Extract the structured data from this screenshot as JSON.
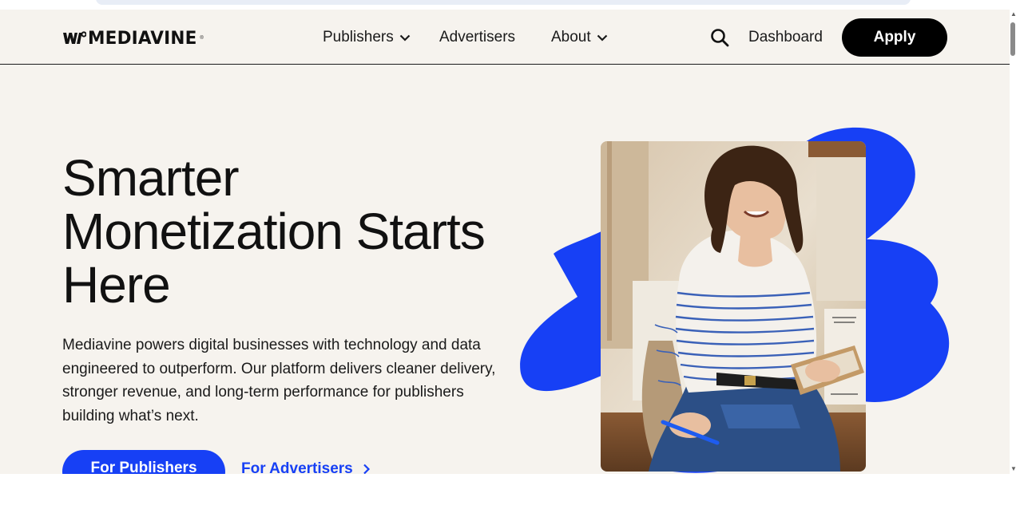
{
  "brand": {
    "name": "MEDIAVINE",
    "accent_color": "#1740f5",
    "background_color": "#f6f3ee"
  },
  "nav": {
    "items": [
      {
        "label": "Publishers",
        "has_dropdown": true
      },
      {
        "label": "Advertisers",
        "has_dropdown": false
      },
      {
        "label": "About",
        "has_dropdown": true
      }
    ],
    "search_icon": "search-icon",
    "dashboard_label": "Dashboard",
    "apply_label": "Apply"
  },
  "hero": {
    "title_lines": [
      "Smarter",
      "Monetization Starts",
      "Here"
    ],
    "description": "Mediavine powers digital businesses with technology and data engineered to outperform. Our platform delivers cleaner delivery, stronger revenue, and long-term performance for publishers building what’s next.",
    "primary_button": "For Publishers",
    "secondary_link": "For Advertisers"
  }
}
